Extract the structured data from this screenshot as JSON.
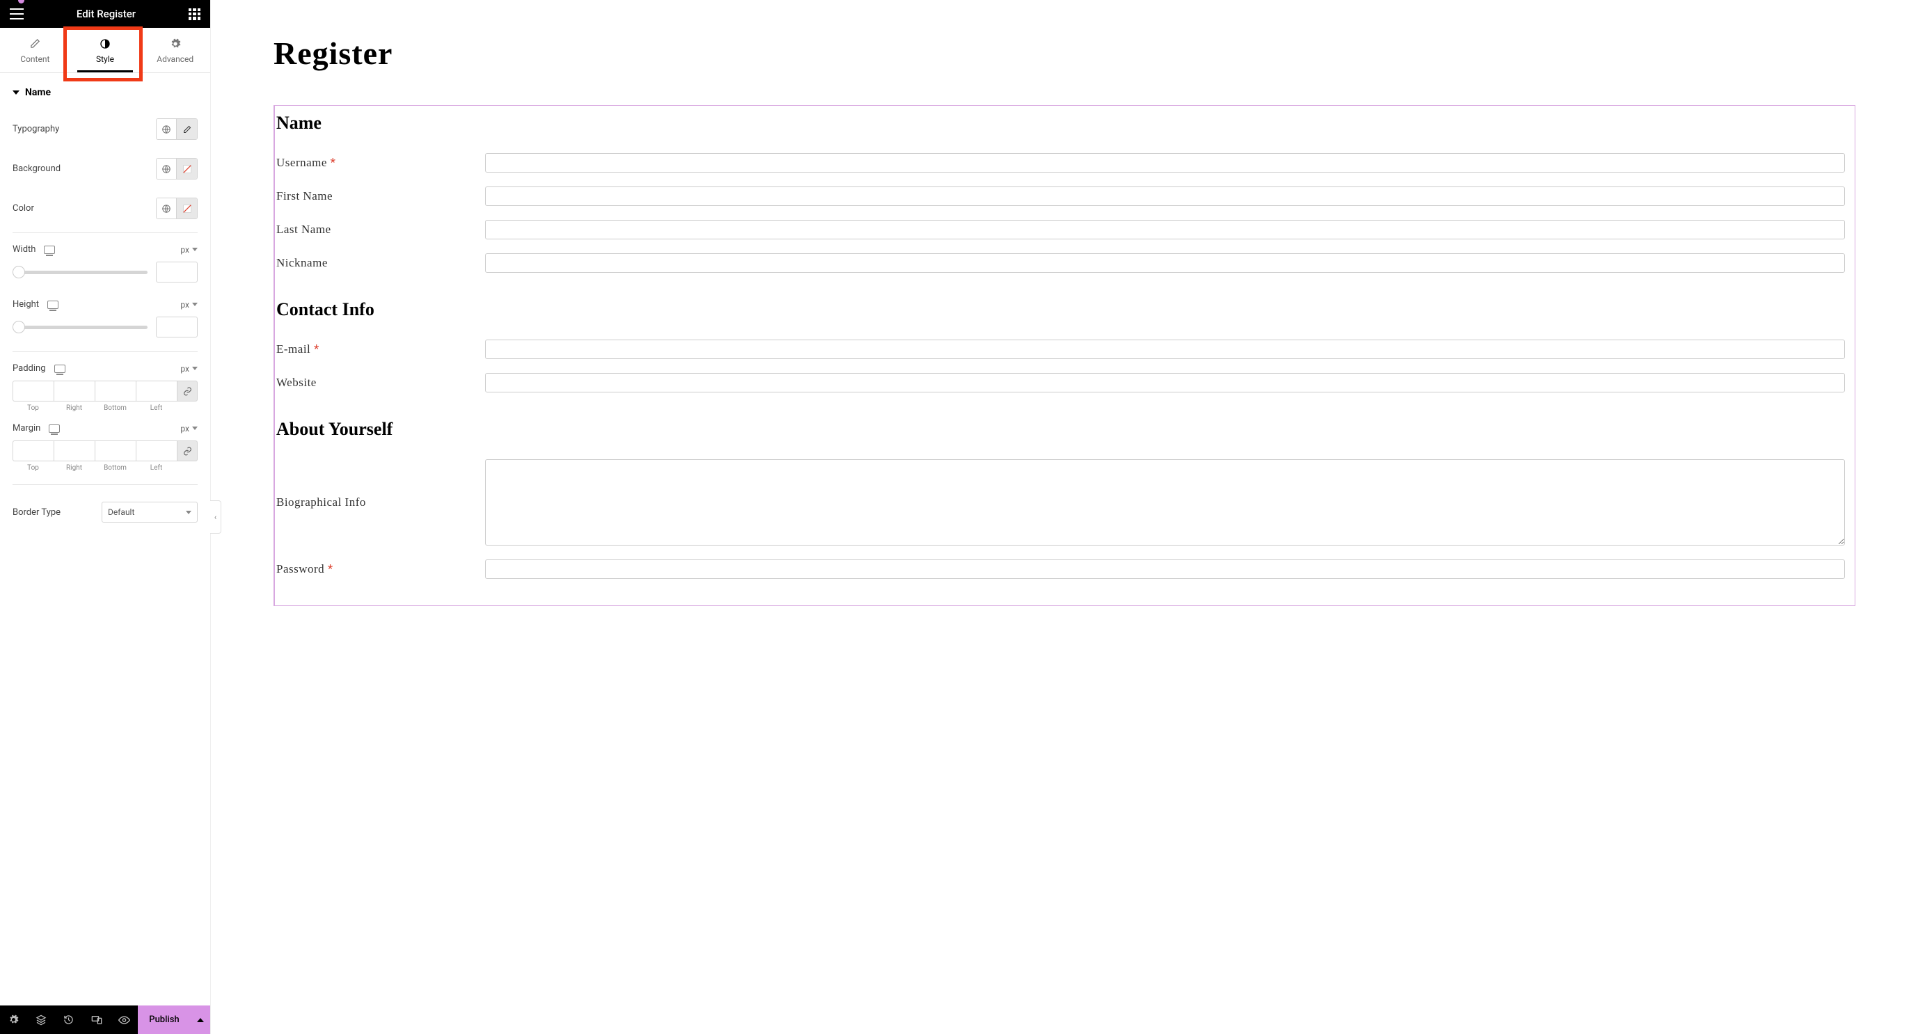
{
  "header": {
    "title": "Edit Register"
  },
  "tabs": [
    {
      "label": "Content",
      "icon": "pencil"
    },
    {
      "label": "Style",
      "icon": "contrast",
      "active": true
    },
    {
      "label": "Advanced",
      "icon": "gear"
    }
  ],
  "style_panel": {
    "section_title": "Name",
    "controls": {
      "typography": {
        "label": "Typography"
      },
      "background": {
        "label": "Background"
      },
      "color": {
        "label": "Color"
      },
      "width": {
        "label": "Width",
        "unit": "px",
        "value": ""
      },
      "height": {
        "label": "Height",
        "unit": "px",
        "value": ""
      },
      "padding": {
        "label": "Padding",
        "unit": "px",
        "sides": [
          "Top",
          "Right",
          "Bottom",
          "Left"
        ]
      },
      "margin": {
        "label": "Margin",
        "unit": "px",
        "sides": [
          "Top",
          "Right",
          "Bottom",
          "Left"
        ]
      },
      "border_type": {
        "label": "Border Type",
        "value": "Default"
      }
    }
  },
  "bottom_bar": {
    "publish": "Publish"
  },
  "canvas": {
    "page_title": "Register",
    "sections": [
      {
        "heading": "Name",
        "fields": [
          {
            "label": "Username",
            "required": true,
            "type": "text"
          },
          {
            "label": "First Name",
            "required": false,
            "type": "text"
          },
          {
            "label": "Last Name",
            "required": false,
            "type": "text"
          },
          {
            "label": "Nickname",
            "required": false,
            "type": "text"
          }
        ]
      },
      {
        "heading": "Contact Info",
        "fields": [
          {
            "label": "E-mail",
            "required": true,
            "type": "text"
          },
          {
            "label": "Website",
            "required": false,
            "type": "text"
          }
        ]
      },
      {
        "heading": "About Yourself",
        "fields": [
          {
            "label": "Biographical Info",
            "required": false,
            "type": "textarea"
          },
          {
            "label": "Password",
            "required": true,
            "type": "text"
          }
        ]
      }
    ]
  }
}
